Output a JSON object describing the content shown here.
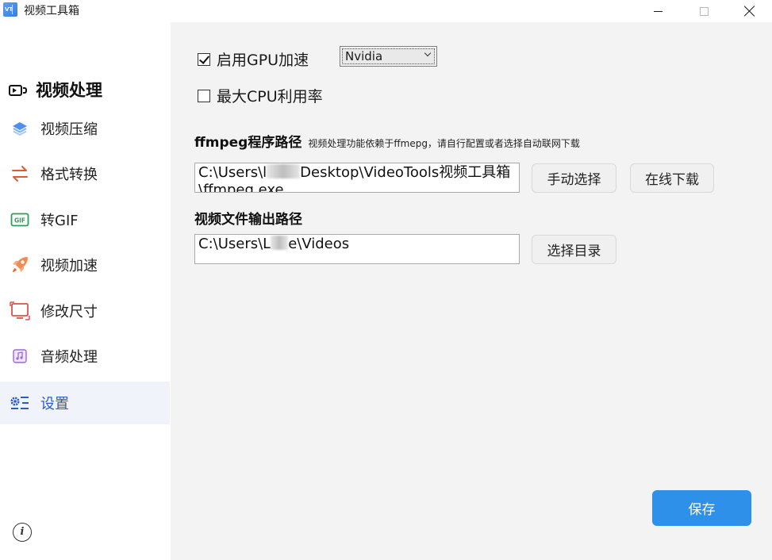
{
  "window": {
    "title": "视频工具箱",
    "app_icon_text": "VT"
  },
  "sidebar": {
    "header": "视频处理",
    "items": [
      {
        "label": "视频压缩",
        "icon": "layers-icon"
      },
      {
        "label": "格式转换",
        "icon": "convert-arrows-icon"
      },
      {
        "label": "转GIF",
        "icon": "gif-icon"
      },
      {
        "label": "视频加速",
        "icon": "rocket-icon"
      },
      {
        "label": "修改尺寸",
        "icon": "resize-screen-icon"
      },
      {
        "label": "音频处理",
        "icon": "music-note-icon"
      },
      {
        "label": "设置",
        "icon": "settings-icon",
        "active": true
      }
    ],
    "info_icon": "info-icon"
  },
  "settings": {
    "gpu_label": "启用GPU加速",
    "gpu_checked": true,
    "gpu_vendor": "Nvidia",
    "cpu_label": "最大CPU利用率",
    "cpu_checked": false,
    "ffmpeg_title": "ffmpeg程序路径",
    "ffmpeg_hint": "视频处理功能依赖于ffmepg，请自行配置或者选择自动联网下载",
    "ffmpeg_path_prefix": "C:\\Users\\l",
    "ffmpeg_path_suffix": "Desktop\\VideoTools视频工具箱\\ffmpeg.exe",
    "manual_select": "手动选择",
    "online_download": "在线下载",
    "output_title": "视频文件输出路径",
    "output_path_prefix": "C:\\Users\\L",
    "output_path_suffix": "e\\Videos",
    "choose_dir": "选择目录",
    "save": "保存"
  },
  "colors": {
    "accent": "#2f90ea",
    "active_bg": "#f0f4fa",
    "active_text": "#2a5cc8"
  }
}
